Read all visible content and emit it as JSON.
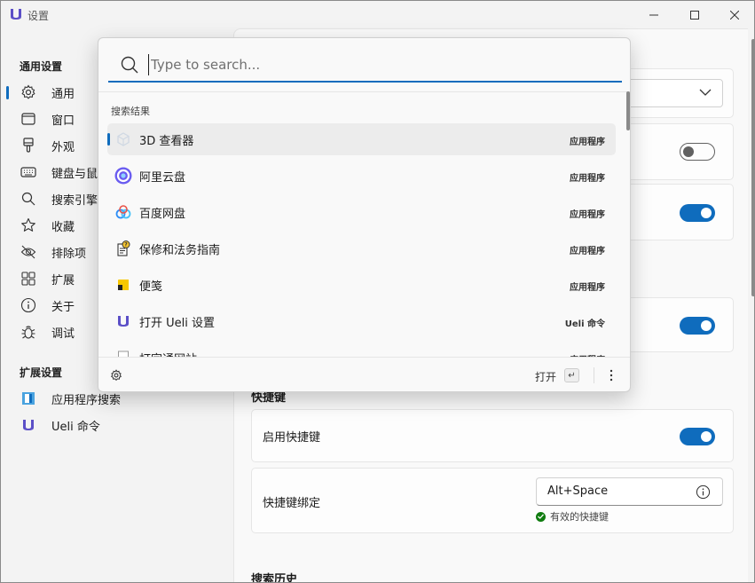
{
  "window": {
    "title": "设置"
  },
  "sidebar": {
    "general_section": "通用设置",
    "items": [
      {
        "label": "通用",
        "icon": "gear-icon"
      },
      {
        "label": "窗口",
        "icon": "window-icon"
      },
      {
        "label": "外观",
        "icon": "paintbrush-icon"
      },
      {
        "label": "键盘与鼠",
        "icon": "keyboard-icon"
      },
      {
        "label": "搜索引擎",
        "icon": "search-icon"
      },
      {
        "label": "收藏",
        "icon": "star-icon"
      },
      {
        "label": "排除项",
        "icon": "eye-off-icon"
      },
      {
        "label": "扩展",
        "icon": "extensions-icon"
      },
      {
        "label": "关于",
        "icon": "info-icon"
      },
      {
        "label": "调试",
        "icon": "bug-icon"
      }
    ],
    "extension_section": "扩展设置",
    "extensions": [
      {
        "label": "应用程序搜索",
        "icon": "app-search-icon"
      },
      {
        "label": "Ueli 命令",
        "icon": "ueli-logo-icon"
      }
    ]
  },
  "main": {
    "hotkey_section": "快捷键",
    "enable_hotkey_label": "启用快捷键",
    "hotkey_binding_label": "快捷键绑定",
    "hotkey_value": "Alt+Space",
    "hotkey_valid": "有效的快捷键",
    "search_history_section": "搜索历史"
  },
  "popup": {
    "search_placeholder": "Type to search...",
    "search_value": "",
    "results_title": "搜索结果",
    "results": [
      {
        "name": "3D 查看器",
        "type": "应用程序",
        "icon": "3d-viewer-icon",
        "selected": true
      },
      {
        "name": "阿里云盘",
        "type": "应用程序",
        "icon": "aliyun-drive-icon",
        "selected": false
      },
      {
        "name": "百度网盘",
        "type": "应用程序",
        "icon": "baidu-netdisk-icon",
        "selected": false
      },
      {
        "name": "保修和法务指南",
        "type": "应用程序",
        "icon": "warranty-guide-icon",
        "selected": false
      },
      {
        "name": "便笺",
        "type": "应用程序",
        "icon": "sticky-notes-icon",
        "selected": false
      },
      {
        "name": "打开 Ueli 设置",
        "type": "Ueli 命令",
        "icon": "ueli-logo-icon",
        "selected": false
      },
      {
        "name": "打字通网站",
        "type": "应用程序",
        "icon": "document-icon",
        "selected": false
      }
    ],
    "open_label": "打开",
    "enter_key": "↵"
  },
  "colors": {
    "accent": "#0f6cbd",
    "valid": "#107c10"
  }
}
